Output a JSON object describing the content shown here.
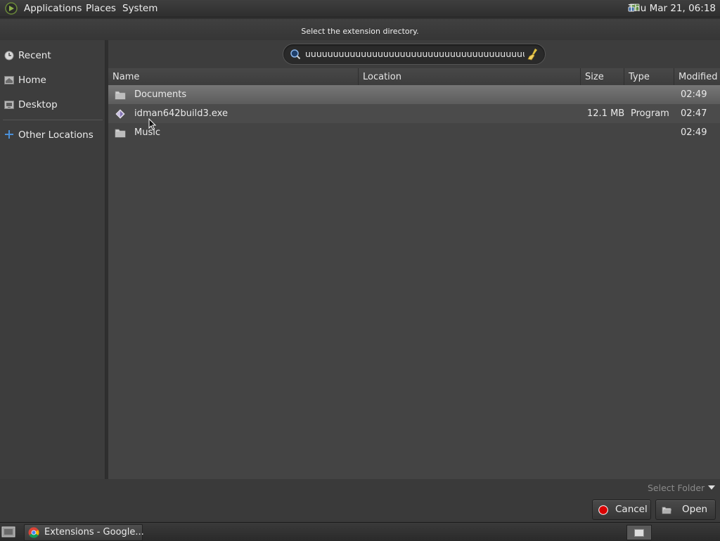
{
  "top_panel": {
    "menus": [
      "Applications",
      "Places",
      "System"
    ],
    "clock": "Thu Mar 21, 06:18"
  },
  "dialog": {
    "title": "Select the extension directory.",
    "search": {
      "value": "uuuuuuuuuuuuuuuuuuuuuuuuuuuuuuuuuuuuuuuuuuuuuuu"
    },
    "sidebar": {
      "items": [
        {
          "label": "Recent",
          "icon": "recent-icon"
        },
        {
          "label": "Home",
          "icon": "home-icon"
        },
        {
          "label": "Desktop",
          "icon": "desktop-icon"
        },
        {
          "label": "Other Locations",
          "icon": "plus-icon"
        }
      ]
    },
    "columns": [
      "Name",
      "Location",
      "Size",
      "Type",
      "Modified"
    ],
    "files": [
      {
        "name": "Documents",
        "location": "",
        "size": "",
        "type": "",
        "modified": "02:49",
        "icon": "folder-icon"
      },
      {
        "name": "idman642build3.exe",
        "location": "",
        "size": "12.1 MB",
        "type": "Program",
        "modified": "02:47",
        "icon": "executable-icon"
      },
      {
        "name": "Music",
        "location": "",
        "size": "",
        "type": "",
        "modified": "02:49",
        "icon": "folder-icon"
      }
    ],
    "filter": "Select Folder",
    "buttons": {
      "cancel": "Cancel",
      "open": "Open"
    }
  },
  "taskbar": {
    "tasks": [
      {
        "label": "Extensions - Google...",
        "icon": "chrome-icon"
      }
    ]
  },
  "colors": {
    "selection": "#6a6a6a",
    "background": "#444444",
    "cancel_icon": "#d90000"
  }
}
